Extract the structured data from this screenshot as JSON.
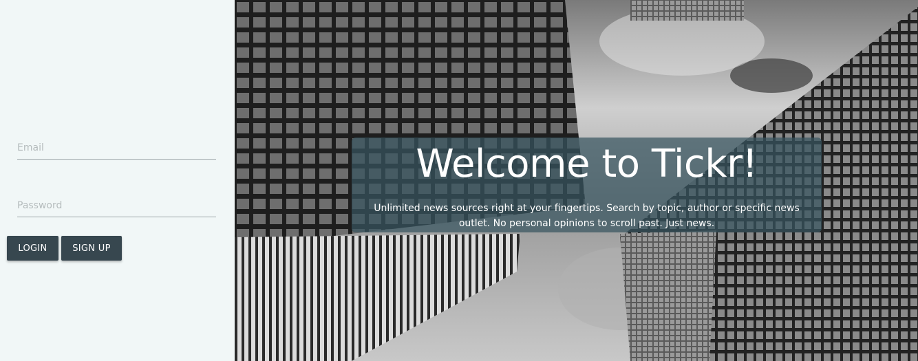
{
  "login": {
    "email_placeholder": "Email",
    "password_placeholder": "Password",
    "login_label": "LOGIN",
    "signup_label": "SIGN UP"
  },
  "hero": {
    "title": "Welcome to Tickr!",
    "subtitle": "Unlimited news sources right at your fingertips. Search by topic, author or specific news outlet. No personal opinions to scroll past. Just news.",
    "overlay_color": "#37555f"
  },
  "colors": {
    "panel_background": "#f1f7f7",
    "button_background": "#37474f",
    "button_text": "#ffffff"
  }
}
